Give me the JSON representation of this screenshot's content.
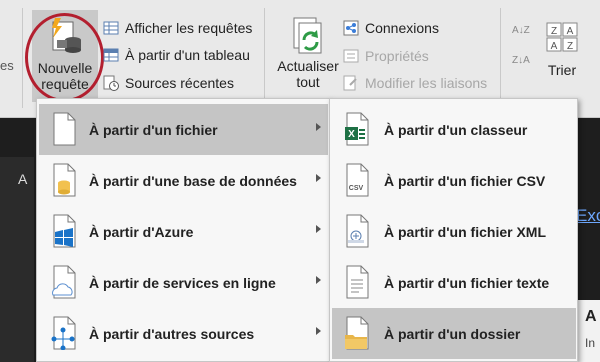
{
  "ribbon": {
    "left_stub": "es",
    "afficher_requetes": "Afficher les requêtes",
    "partir_tableau": "À partir d'un tableau",
    "sources_recentes": "Sources récentes",
    "nouvelle_line1": "Nouvelle",
    "nouvelle_line2": "requête",
    "actualiser_line1": "Actualiser",
    "actualiser_line2": "tout",
    "connexions": "Connexions",
    "proprietes": "Propriétés",
    "modifier_liaisons": "Modifier les liaisons",
    "sort_az": "A↓Z",
    "sort_za": "Z↓A",
    "trier": "Trier"
  },
  "background": {
    "tab_letter": "A",
    "right_link": "Exc",
    "right_pane_title": "A",
    "right_pane_text": "In"
  },
  "menu_sources": {
    "items": [
      {
        "label": "À partir d'un fichier",
        "active": true
      },
      {
        "label": "À partir d'une base de données",
        "active": false
      },
      {
        "label": "À partir d'Azure",
        "active": false
      },
      {
        "label": "À partir de services en ligne",
        "active": false
      },
      {
        "label": "À partir d'autres sources",
        "active": false
      }
    ]
  },
  "menu_fichier": {
    "items": [
      {
        "label": "À partir d'un classeur",
        "icon": "excel-workbook-icon",
        "active": false
      },
      {
        "label": "À partir d'un fichier CSV",
        "icon": "csv-file-icon",
        "icon_text": "CSV",
        "active": false
      },
      {
        "label": "À partir d'un fichier XML",
        "icon": "xml-file-icon",
        "active": false
      },
      {
        "label": "À partir d'un fichier texte",
        "icon": "text-file-icon",
        "active": false
      },
      {
        "label": "À partir d'un dossier",
        "icon": "folder-icon",
        "active": true
      }
    ]
  },
  "colors": {
    "highlight_circle": "#b31f2f",
    "excel_green": "#1e7145",
    "azure_blue": "#1a73c8",
    "folder_yellow": "#e8b64a"
  }
}
